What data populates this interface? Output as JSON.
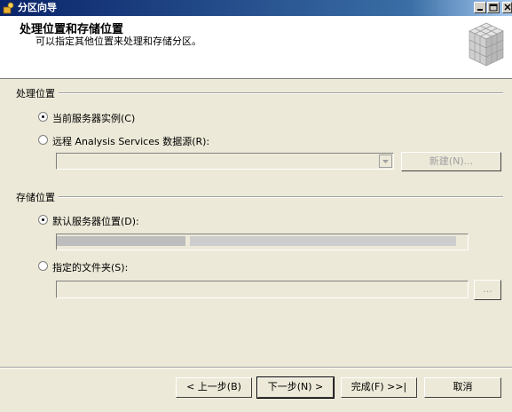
{
  "window": {
    "title": "分区向导"
  },
  "header": {
    "title": "处理位置和存储位置",
    "subtitle": "可以指定其他位置来处理和存储分区。"
  },
  "processing": {
    "group_label": "处理位置",
    "option_current": "当前服务器实例(C)",
    "option_remote": "远程 Analysis Services 数据源(R):",
    "new_button": "新建(N)..."
  },
  "storage": {
    "group_label": "存储位置",
    "option_default": "默认服务器位置(D):",
    "option_folder": "指定的文件夹(S):",
    "browse_button": "..."
  },
  "footer": {
    "back": "< 上一步(B)",
    "next": "下一步(N) >",
    "finish": "完成(F) >>|",
    "cancel": "取消"
  }
}
